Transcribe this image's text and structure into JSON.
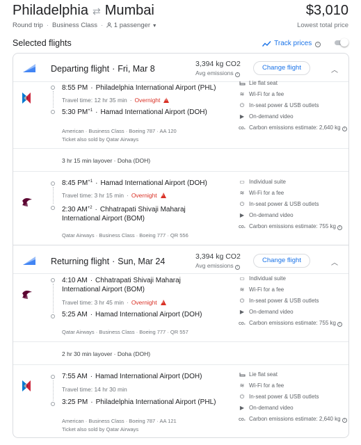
{
  "header": {
    "origin": "Philadelphia",
    "destination": "Mumbai",
    "price": "$3,010",
    "price_note": "Lowest total price",
    "trip_type": "Round trip",
    "cabin": "Business Class",
    "passengers": "1 passenger"
  },
  "selected": {
    "title": "Selected flights",
    "track_label": "Track prices"
  },
  "colors": {
    "accent": "#1a73e8",
    "warning": "#d93025",
    "muted": "#70757a",
    "border": "#dadce0"
  },
  "departing": {
    "title": "Departing flight",
    "date": "Fri, Mar 8",
    "co2": "3,394 kg CO2",
    "co2_note": "Avg emissions",
    "change_label": "Change flight",
    "seg1": {
      "dep_time": "8:55 PM",
      "dep_airport": "Philadelphia International Airport (PHL)",
      "travel": "Travel time: 12 hr 35 min",
      "overnight": "Overnight",
      "arr_time": "5:30 PM",
      "arr_sup": "+1",
      "arr_airport": "Hamad International Airport (DOH)",
      "meta1": "American · Business Class · Boeing 787 · AA 120",
      "meta2": "Ticket also sold by Qatar Airways",
      "amenities": [
        "Lie flat seat",
        "Wi-Fi for a fee",
        "In-seat power & USB outlets",
        "On-demand video",
        "Carbon emissions estimate: 2,640 kg"
      ]
    },
    "layover": "3 hr 15 min layover · Doha (DOH)",
    "seg2": {
      "dep_time": "8:45 PM",
      "dep_sup": "+1",
      "dep_airport": "Hamad International Airport (DOH)",
      "travel": "Travel time: 3 hr 15 min",
      "overnight": "Overnight",
      "arr_time": "2:30 AM",
      "arr_sup": "+2",
      "arr_airport": "Chhatrapati Shivaji Maharaj International Airport (BOM)",
      "meta1": "Qatar Airways · Business Class · Boeing 777 · QR 556",
      "amenities": [
        "Individual suite",
        "Wi-Fi for a fee",
        "In-seat power & USB outlets",
        "On-demand video",
        "Carbon emissions estimate: 755 kg"
      ]
    }
  },
  "returning": {
    "title": "Returning flight",
    "date": "Sun, Mar 24",
    "co2": "3,394 kg CO2",
    "co2_note": "Avg emissions",
    "change_label": "Change flight",
    "seg1": {
      "dep_time": "4:10 AM",
      "dep_airport": "Chhatrapati Shivaji Maharaj International Airport (BOM)",
      "travel": "Travel time: 3 hr 45 min",
      "overnight": "Overnight",
      "arr_time": "5:25 AM",
      "arr_airport": "Hamad International Airport (DOH)",
      "meta1": "Qatar Airways · Business Class · Boeing 777 · QR 557",
      "amenities": [
        "Individual suite",
        "Wi-Fi for a fee",
        "In-seat power & USB outlets",
        "On-demand video",
        "Carbon emissions estimate: 755 kg"
      ]
    },
    "layover": "2 hr 30 min layover · Doha (DOH)",
    "seg2": {
      "dep_time": "7:55 AM",
      "dep_airport": "Hamad International Airport (DOH)",
      "travel": "Travel time: 14 hr 30 min",
      "arr_time": "3:25 PM",
      "arr_airport": "Philadelphia International Airport (PHL)",
      "meta1": "American · Business Class · Boeing 787 · AA 121",
      "meta2": "Ticket also sold by Qatar Airways",
      "amenities": [
        "Lie flat seat",
        "Wi-Fi for a fee",
        "In-seat power & USB outlets",
        "On-demand video",
        "Carbon emissions estimate: 2,640 kg"
      ]
    }
  }
}
